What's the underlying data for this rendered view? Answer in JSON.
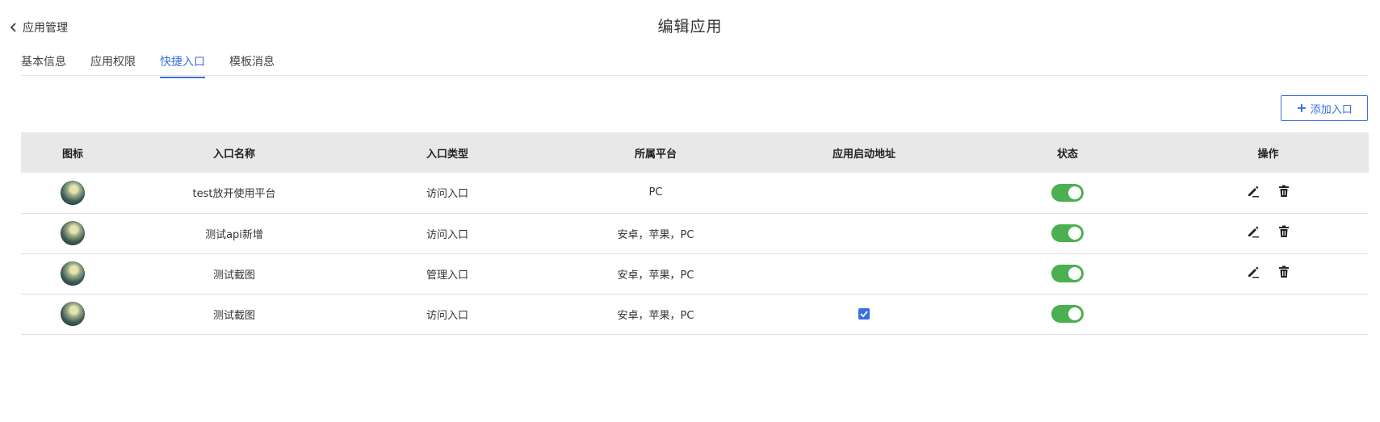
{
  "header": {
    "back_label": "应用管理",
    "title": "编辑应用"
  },
  "tabs": [
    {
      "label": "基本信息",
      "active": false
    },
    {
      "label": "应用权限",
      "active": false
    },
    {
      "label": "快捷入口",
      "active": true
    },
    {
      "label": "模板消息",
      "active": false
    }
  ],
  "toolbar": {
    "add_plus": "+",
    "add_label": "添加入口"
  },
  "table": {
    "columns": [
      "图标",
      "入口名称",
      "入口类型",
      "所属平台",
      "应用启动地址",
      "状态",
      "操作"
    ],
    "rows": [
      {
        "icon": "avatar-icon",
        "name": "test放开使用平台",
        "type": "访问入口",
        "platform": "PC",
        "launch_checked": false,
        "status_on": true,
        "has_actions": true
      },
      {
        "icon": "avatar-icon",
        "name": "测试api新增",
        "type": "访问入口",
        "platform": "安卓，苹果，PC",
        "launch_checked": false,
        "status_on": true,
        "has_actions": true
      },
      {
        "icon": "avatar-icon",
        "name": "测试截图",
        "type": "管理入口",
        "platform": "安卓，苹果，PC",
        "launch_checked": false,
        "status_on": true,
        "has_actions": true
      },
      {
        "icon": "avatar-icon",
        "name": "测试截图",
        "type": "访问入口",
        "platform": "安卓，苹果，PC",
        "launch_checked": true,
        "status_on": true,
        "has_actions": false
      }
    ]
  },
  "colors": {
    "accent": "#3b6fe0",
    "toggle_on": "#4caf50",
    "header_bg": "#e8e8e8"
  }
}
